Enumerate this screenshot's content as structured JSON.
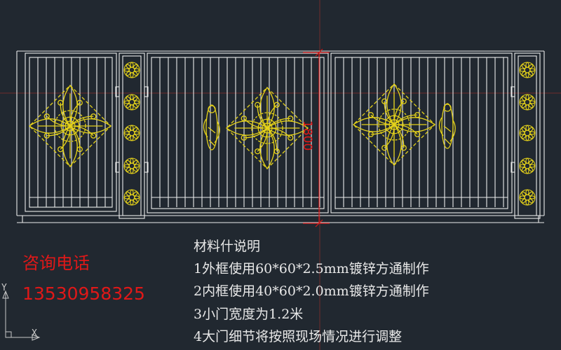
{
  "drawing": {
    "dimension_label": "1800",
    "colors": {
      "background": "#212830",
      "lines": "#ececec",
      "ornament": "#e5d21a",
      "dimension": "#d81818",
      "crosshair": "#7a2a2a"
    }
  },
  "notes": {
    "title": "材料什说明",
    "lines": [
      "1外框使用60*60*2.5mm镀锌方通制作",
      "2内框使用40*60*2.0mm镀锌方通制作",
      "3小门宽度为1.2米",
      "4大门细节将按照现场情况进行调整"
    ]
  },
  "contact": {
    "label": "咨询电话",
    "phone": "13530958325"
  },
  "ucs": {
    "x_label": "X",
    "y_label": "Y"
  }
}
